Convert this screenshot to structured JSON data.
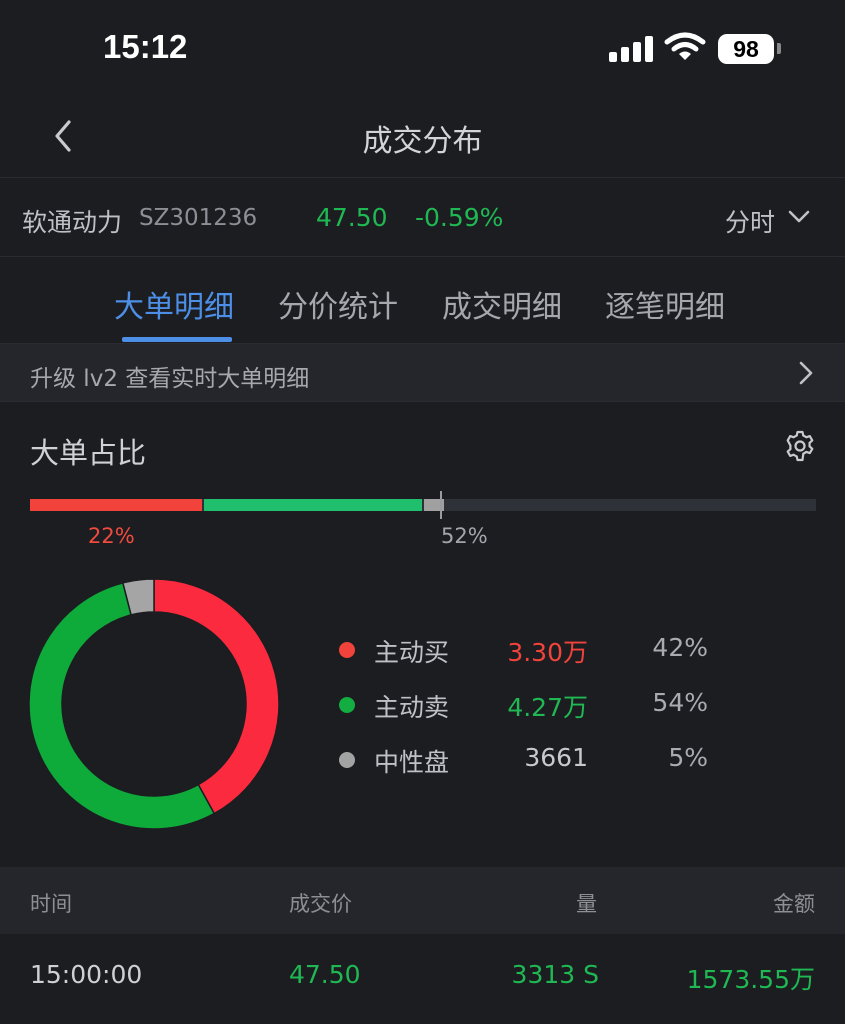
{
  "status": {
    "time": "15:12",
    "battery": "98"
  },
  "nav": {
    "title": "成交分布"
  },
  "stock": {
    "name": "软通动力",
    "code": "SZ301236",
    "price": "47.50",
    "change": "-0.59%",
    "period": "分时"
  },
  "tabs": [
    {
      "label": "大单明细",
      "active": true
    },
    {
      "label": "分价统计",
      "active": false
    },
    {
      "label": "成交明细",
      "active": false
    },
    {
      "label": "逐笔明细",
      "active": false
    }
  ],
  "upgrade": {
    "text": "升级 lv2 查看实时大单明细"
  },
  "section": {
    "title": "大单占比"
  },
  "ratio_bar": {
    "buy_fraction": 0.22,
    "sell_fraction": 0.28,
    "neutral_fraction": 0.025,
    "label_left": "22%",
    "label_right": "52%",
    "colors": {
      "buy": "#f1433c",
      "sell": "#20bf6e",
      "neutral": "#a0a0a0"
    }
  },
  "legend": [
    {
      "label": "主动买",
      "value": "3.30万",
      "pct": "42%",
      "color": "#f1433c",
      "value_color": "#f1433c"
    },
    {
      "label": "主动卖",
      "value": "4.27万",
      "pct": "54%",
      "color": "#14ad41",
      "value_color": "#1fb853"
    },
    {
      "label": "中性盘",
      "value": "3661",
      "pct": "5%",
      "color": "#a3a3a3",
      "value_color": "#c8c9cd"
    }
  ],
  "donut": {
    "slices": [
      {
        "name": "主动买",
        "fraction": 0.42,
        "color": "#fc2a3e"
      },
      {
        "name": "主动卖",
        "fraction": 0.54,
        "color": "#0eab3b"
      },
      {
        "name": "中性盘",
        "fraction": 0.04,
        "color": "#a5a5a5"
      }
    ]
  },
  "table": {
    "headers": {
      "time": "时间",
      "price": "成交价",
      "volume": "量",
      "amount": "金额"
    },
    "rows": [
      {
        "time": "15:00:00",
        "price": "47.50",
        "volume": "3313 S",
        "amount": "1573.55万"
      }
    ]
  }
}
